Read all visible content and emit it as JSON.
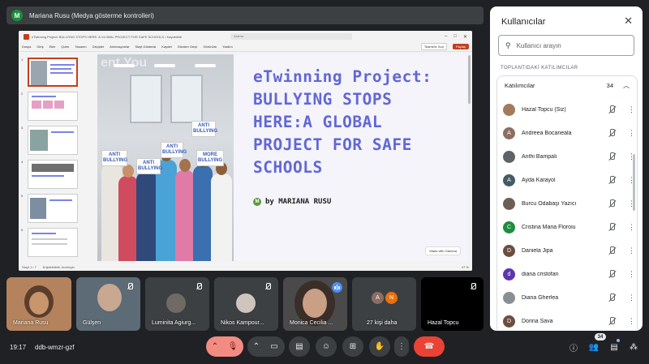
{
  "presenter": {
    "initial": "M",
    "label": "Mariana Rusu (Medya gösterme kontrolleri)"
  },
  "ppt": {
    "title_text": "eTwinning Project: BULLYING STOPS HERE: A GLOBAL PROJECT FOR SAFE SCHOOLS • Kaydedildi",
    "search_placeholder": "Arama",
    "ribbon_tabs": [
      "Dosya",
      "Giriş",
      "Ekle",
      "Çizim",
      "Tasarım",
      "Geçişler",
      "Animasyonlar",
      "Slayt Gösterisi",
      "Kaydet",
      "Gözden Geçir",
      "Görünüm",
      "Yardım"
    ],
    "share_label": "Teams'te Sun",
    "present_label": "Paylaş",
    "status_left": "Slayt 1 / 7",
    "status_mid": "Erişilebilirlik: İnceleyin",
    "zoom": "47 %"
  },
  "slide": {
    "photo_text": "ent You",
    "title": "eTwinning Project: BULLYING STOPS HERE:A GLOBAL PROJECT FOR SAFE SCHOOLS",
    "author_initial": "M",
    "author": "by MARIANA RUSU",
    "badge": "Made with Gamma",
    "signs": [
      "ANTI BULLYING",
      "ANTI BULLYING",
      "ANTI BULLYING",
      "ANTI BULLYING",
      "MORE BULLYING"
    ]
  },
  "thumbs": [
    "1",
    "2",
    "3",
    "4",
    "5",
    "6"
  ],
  "panel": {
    "title": "Kullanıcılar",
    "close": "✕",
    "search_placeholder": "Kullanıcı arayın",
    "section": "TOPLANTIDAKİ KATILIMCILAR",
    "group_label": "Katılımcılar",
    "group_count": "34",
    "participants": [
      {
        "name": "Hazal Topcu (Siz)",
        "initial": "",
        "color": "#a27b5c"
      },
      {
        "name": "Andreea Bocaneala",
        "initial": "A",
        "color": "#8d6e63"
      },
      {
        "name": "Anthi Bampali",
        "initial": "",
        "color": "#5f6368"
      },
      {
        "name": "Ayda Karayol",
        "initial": "A",
        "color": "#455a64"
      },
      {
        "name": "Burcu Odabaşı Yazıcı",
        "initial": "",
        "color": "#6d5f55"
      },
      {
        "name": "Cristina Maria Floroiu",
        "initial": "C",
        "color": "#1e8e3e"
      },
      {
        "name": "Daniela Jipa",
        "initial": "D",
        "color": "#6d4c41"
      },
      {
        "name": "diana cristofan",
        "initial": "d",
        "color": "#5e35b1"
      },
      {
        "name": "Diana Gherlea",
        "initial": "",
        "color": "#8a8f94"
      },
      {
        "name": "Dorina Sava",
        "initial": "D",
        "color": "#6d4c41"
      }
    ]
  },
  "tiles": [
    {
      "name": "Mariana Rusu"
    },
    {
      "name": "Gülşen"
    },
    {
      "name": "Luminita Agiurg..."
    },
    {
      "name": "Nikos Kampour..."
    },
    {
      "name": "Monica Cecilia ..."
    },
    {
      "name": "27 kişi daha"
    },
    {
      "name": "Hazal Topcu"
    }
  ],
  "more_avatars": [
    {
      "initial": "A",
      "color": "#8d6e63"
    },
    {
      "initial": "N",
      "color": "#e8710a"
    }
  ],
  "bottom": {
    "time": "19:17",
    "code": "ddb-wmzr-gzf",
    "people_count": "34"
  }
}
